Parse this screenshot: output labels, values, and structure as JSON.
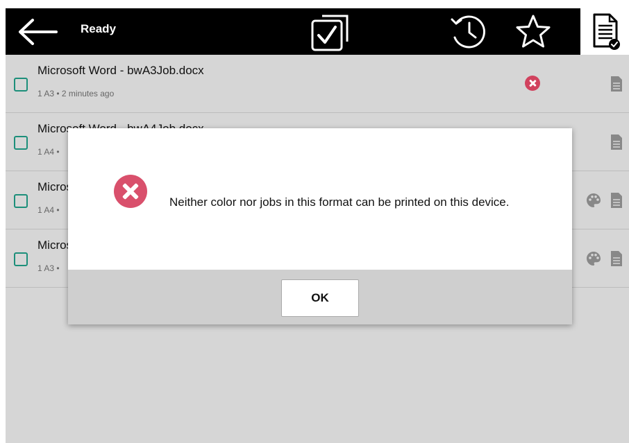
{
  "topbar": {
    "status": "Ready",
    "icons": [
      "back-arrow-icon",
      "select-all-icon",
      "history-icon",
      "star-icon",
      "print-jobs-icon"
    ]
  },
  "jobs": [
    {
      "title": "Microsoft Word - bwA3Job.docx",
      "meta": "1 A3 • 2 minutes ago"
    },
    {
      "title": "Microsoft Word - bwA4Job.docx",
      "meta": "1 A4 • "
    },
    {
      "title": "Micros",
      "meta": "1 A4 • "
    },
    {
      "title": "Micros",
      "meta": "1 A3 • "
    }
  ],
  "dialog": {
    "message": "Neither color nor jobs in this format can be printed on this device.",
    "ok_label": "OK"
  },
  "colors": {
    "topbar": "#000000",
    "background": "#d6d6d6",
    "error": "#d9506c",
    "checkbox": "#1c8f7a"
  }
}
